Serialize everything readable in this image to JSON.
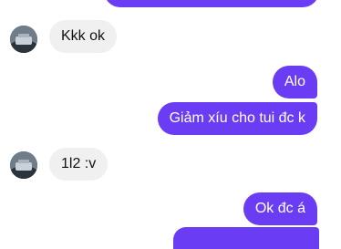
{
  "colors": {
    "outgoing_bubble": "#6a3cf3",
    "incoming_bubble": "#f0f0f0",
    "incoming_text": "#111111",
    "outgoing_text": "#ffffff"
  },
  "messages": [
    {
      "direction": "out",
      "text": ""
    },
    {
      "direction": "in",
      "text": "Kkk ok",
      "avatar": "contact-avatar"
    },
    {
      "direction": "out",
      "text": "Alo"
    },
    {
      "direction": "out",
      "text": "Giảm xíu cho tui đc k"
    },
    {
      "direction": "in",
      "text": "1l2 :v",
      "avatar": "contact-avatar"
    },
    {
      "direction": "out",
      "text": "Ok đc á"
    },
    {
      "direction": "out",
      "text": ""
    }
  ]
}
